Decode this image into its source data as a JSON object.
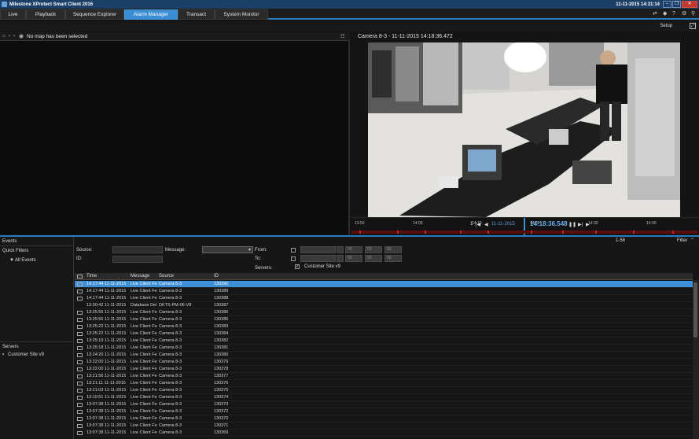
{
  "window": {
    "title": "Milestone XProtect Smart Client 2016",
    "clock": "11-11-2015 14:31:14"
  },
  "tabs": [
    {
      "label": "Live"
    },
    {
      "label": "Playback"
    },
    {
      "label": "Sequence Explorer"
    },
    {
      "label": "Alarm Manager"
    },
    {
      "label": "Transact"
    },
    {
      "label": "System Monitor"
    }
  ],
  "setup_label": "Setup",
  "map": {
    "message": "No map has been selected"
  },
  "camera": {
    "title": "Camera 8-3 - 11-11-2015 14:18:36.472"
  },
  "timeline": {
    "ticks": [
      "13:50",
      "14:00",
      "14:10",
      "14:20",
      "14:30",
      "14:40"
    ],
    "speed": "1",
    "date": "11-11-2015",
    "time": "14:18:36.548"
  },
  "events_panel": {
    "title": "Events",
    "quick_filters": "Quick Filters",
    "all_events": "All Events",
    "servers_title": "Servers",
    "server_item": "Customer Site v9",
    "count": "1-56",
    "filter_label": "Filter"
  },
  "filters": {
    "source_label": "Source:",
    "message_label": "Message:",
    "id_label": "ID:",
    "from_label": "From:",
    "to_label": "To:",
    "servers_label": "Servers:",
    "server_option": "Customer Site v9",
    "time_placeholders": [
      "00",
      "00",
      "00"
    ]
  },
  "table": {
    "columns": [
      "Time",
      "Message",
      "Source",
      "ID"
    ],
    "rows": [
      {
        "time": "14:17:44 11-11-2015",
        "message": "Live Client Fe",
        "source": "Camera 8-3",
        "id": "130390"
      },
      {
        "time": "14:17:44 11-11-2015",
        "message": "Live Client Fe",
        "source": "Camera 8-3",
        "id": "130389"
      },
      {
        "time": "14:17:44 11-11-2015",
        "message": "Live Client Fe",
        "source": "Camera 8-3",
        "id": "130388"
      },
      {
        "time": "13:30:42 11-11-2015",
        "message": "Database Del",
        "source": "DKTS-PM-06-V8",
        "id": "130387"
      },
      {
        "time": "13:25:55 11-11-2015",
        "message": "Live Client Fe",
        "source": "Camera 8-3",
        "id": "130386"
      },
      {
        "time": "13:25:55 11-11-2015",
        "message": "Live Client Fe",
        "source": "Camera 8-3",
        "id": "130385"
      },
      {
        "time": "13:25:22 11-11-2015",
        "message": "Live Client Fe",
        "source": "Camera 8-3",
        "id": "130383"
      },
      {
        "time": "13:25:22 11-11-2015",
        "message": "Live Client Fe",
        "source": "Camera 8-3",
        "id": "130384"
      },
      {
        "time": "13:25:19 11-11-2015",
        "message": "Live Client Fe",
        "source": "Camera 8-3",
        "id": "130382"
      },
      {
        "time": "13:25:18 11-11-2015",
        "message": "Live Client Fe",
        "source": "Camera 8-3",
        "id": "130381"
      },
      {
        "time": "13:24:20 11-11-2015",
        "message": "Live Client Fe",
        "source": "Camera 8-3",
        "id": "130380"
      },
      {
        "time": "13:22:00 11-11-2015",
        "message": "Live Client Fe",
        "source": "Camera 8-3",
        "id": "130379"
      },
      {
        "time": "13:22:00 11-11-2015",
        "message": "Live Client Fe",
        "source": "Camera 8-3",
        "id": "130378"
      },
      {
        "time": "13:21:56 11-11-2015",
        "message": "Live Client Fe",
        "source": "Camera 8-3",
        "id": "130377"
      },
      {
        "time": "13:21:11 11-11-2015",
        "message": "Live Client Fe",
        "source": "Camera 8-3",
        "id": "130376"
      },
      {
        "time": "13:21:03 11-11-2015",
        "message": "Live Client Fe",
        "source": "Camera 8-3",
        "id": "130375"
      },
      {
        "time": "13:10:51 11-11-2015",
        "message": "Live Client Fe",
        "source": "Camera 8-3",
        "id": "130374"
      },
      {
        "time": "13:07:38 11-11-2015",
        "message": "Live Client Fe",
        "source": "Camera 8-3",
        "id": "130373"
      },
      {
        "time": "13:07:38 11-11-2015",
        "message": "Live Client Fe",
        "source": "Camera 8-3",
        "id": "130372"
      },
      {
        "time": "13:07:38 11-11-2015",
        "message": "Live Client Fe",
        "source": "Camera 8-3",
        "id": "130370"
      },
      {
        "time": "13:07:38 11-11-2015",
        "message": "Live Client Fe",
        "source": "Camera 8-3",
        "id": "130371"
      },
      {
        "time": "13:07:38 11-11-2015",
        "message": "Live Client Fe",
        "source": "Camera 8-3",
        "id": "130369"
      }
    ]
  }
}
